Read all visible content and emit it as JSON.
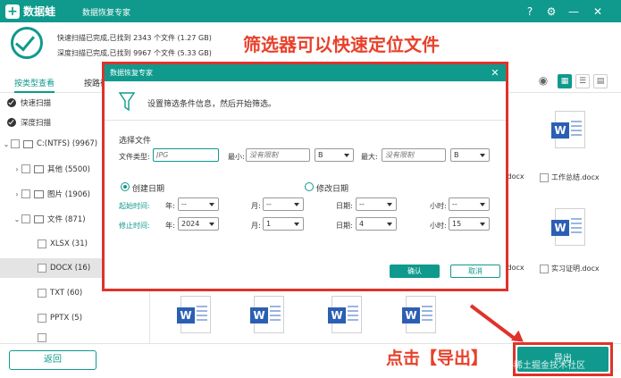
{
  "app": {
    "logo_mark": "+",
    "logo_text": "数据蛙",
    "title": "数据恢复专家"
  },
  "window_controls": {
    "help": "?",
    "settings": "⚙",
    "minimize": "—",
    "close": "✕"
  },
  "scan": {
    "quick": "快速扫描已完成,已找到 2343 个文件 (1.27 GB)",
    "deep": "深度扫描已完成,已找到 9967 个文件 (5.33 GB)"
  },
  "annotations": {
    "filter_tip": "筛选器可以快速定位文件",
    "export_tip": "点击【导出】"
  },
  "tabs": [
    {
      "label": "按类型查看"
    },
    {
      "label": "按路径"
    }
  ],
  "view_buttons": {
    "eye": "◉",
    "grid": "▦",
    "list": "☰",
    "detail": "▤"
  },
  "sidebar": {
    "scan_items": [
      {
        "label": "快速扫描"
      },
      {
        "label": "深度扫描"
      }
    ],
    "tree": [
      {
        "label": "C:(NTFS) (9967)"
      },
      {
        "label": "其他 (5500)"
      },
      {
        "label": "图片 (1906)"
      },
      {
        "label": "文件 (871)"
      },
      {
        "label": "XLSX (31)"
      },
      {
        "label": "DOCX (16)"
      },
      {
        "label": "TXT (60)"
      },
      {
        "label": "PPTX (5)"
      }
    ]
  },
  "files": [
    {
      "name": ".docx"
    },
    {
      "name": "工作总结.docx"
    },
    {
      "name": ".docx"
    },
    {
      "name": "实习证明.docx"
    }
  ],
  "dialog": {
    "title": "数据恢复专家",
    "close": "✕",
    "hint": "设置筛选条件信息，然后开始筛选。",
    "section_title": "选择文件",
    "file_type_label": "文件类型:",
    "file_type_placeholder": "JPG",
    "min_label": "最小:",
    "min_placeholder": "没有限制",
    "min_unit": "B",
    "max_label": "最大:",
    "max_placeholder": "没有限制",
    "max_unit": "B",
    "created_label": "创建日期",
    "modified_label": "修改日期",
    "start_label": "起始时间:",
    "end_label": "修止时间:",
    "year_label": "年:",
    "month_label": "月:",
    "day_label": "日期:",
    "hour_label": "小时:",
    "start": {
      "year": "--",
      "month": "--",
      "day": "--",
      "hour": "--"
    },
    "end": {
      "year": "2024",
      "month": "1",
      "day": "4",
      "hour": "15"
    },
    "ok": "确认",
    "cancel": "取消"
  },
  "bottom": {
    "back": "返回",
    "export": "导出",
    "watermark": "@稀土掘金技术社区"
  },
  "colors": {
    "accent": "#0f9a8d",
    "annotation": "#e0322a",
    "word": "#2b5fb3"
  }
}
